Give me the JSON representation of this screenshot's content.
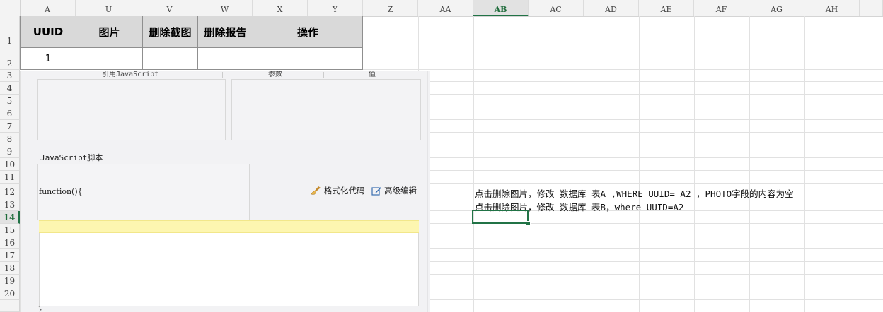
{
  "columns": [
    "A",
    "U",
    "V",
    "W",
    "X",
    "Y",
    "Z",
    "AA",
    "AB",
    "AC",
    "AD",
    "AE",
    "AF",
    "AG",
    "AH"
  ],
  "active_column": "AB",
  "rows": [
    "1",
    "2",
    "3",
    "4",
    "5",
    "6",
    "7",
    "8",
    "9",
    "10",
    "11",
    "12",
    "13",
    "14",
    "15",
    "16",
    "17",
    "18",
    "19",
    "20"
  ],
  "active_row": "14",
  "table": {
    "headers": {
      "uuid": "UUID",
      "image": "图片",
      "delete_screenshot": "删除截图",
      "delete_report": "删除报告",
      "operation": "操作"
    },
    "row1_uuid": "1"
  },
  "dialog": {
    "cut_label_left": "引用JavaScript",
    "cut_label_mid": "参数",
    "cut_label_right": "值",
    "script_label": "JavaScript脚本",
    "function_text": "function(){",
    "format_button": "格式化代码",
    "advanced_button": "高级编辑",
    "close_brace": "}"
  },
  "notes": [
    "点击删除图片，修改 数据库 表A ,WHERE UUID= A2 ，PHOTO字段的内容为空",
    "点击删除图片，修改 数据库 表B，where UUID=A2"
  ],
  "colors": {
    "header_fill": "#d9d9d9",
    "selection": "#217346",
    "highlight_line": "#fdf6b0"
  }
}
